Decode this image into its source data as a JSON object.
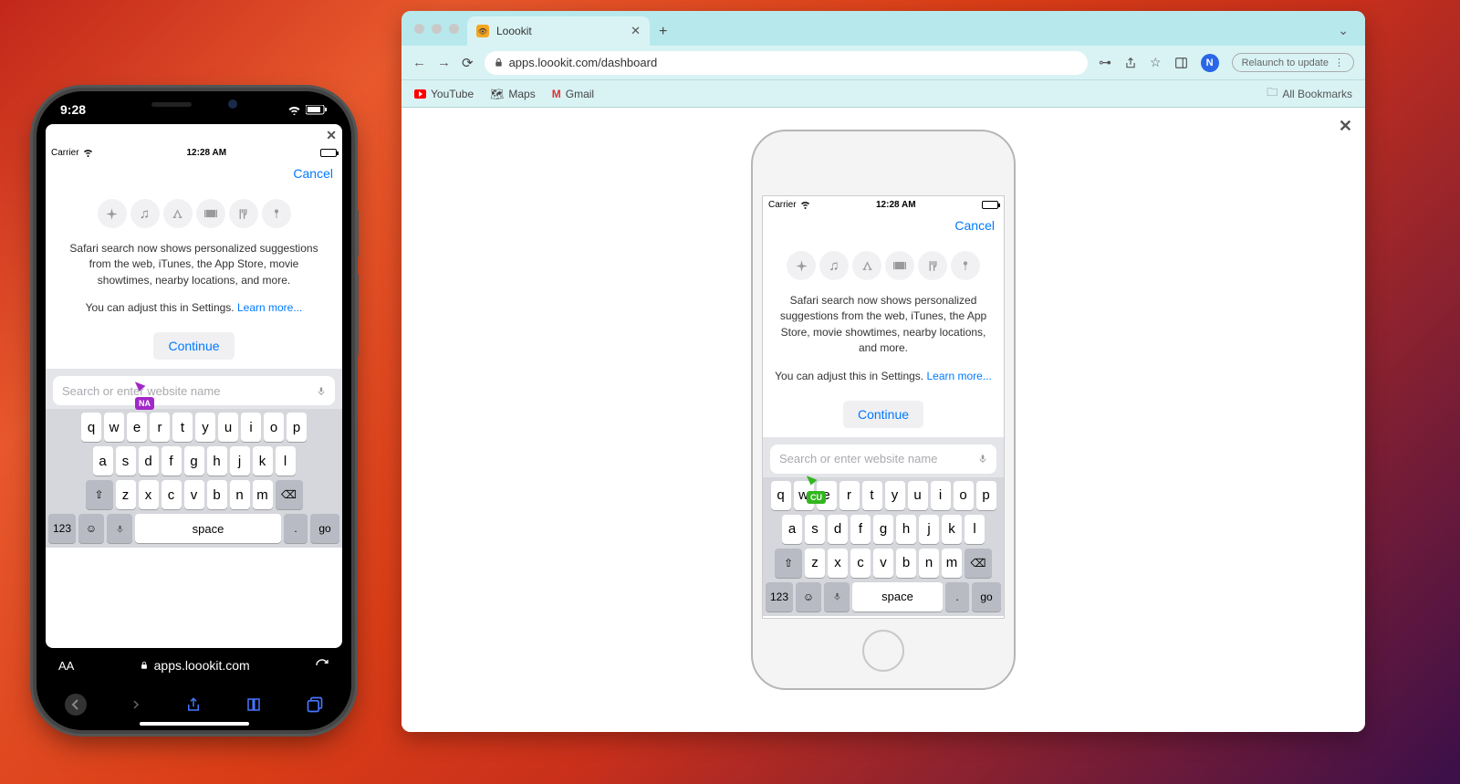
{
  "physical_phone": {
    "status_time": "9:28",
    "tab_indicator": "⌄",
    "safari_url": "apps.loookit.com",
    "aa_button": "AA"
  },
  "browser": {
    "tab_title": "Loookit",
    "address": "apps.loookit.com/dashboard",
    "bookmarks": {
      "yt": "YouTube",
      "maps": "Maps",
      "gmail": "Gmail",
      "all": "All Bookmarks"
    },
    "avatar_letter": "N",
    "relaunch": "Relaunch to update"
  },
  "ios": {
    "carrier": "Carrier",
    "clock": "12:28 AM",
    "cancel": "Cancel",
    "description": "Safari search now shows personalized suggestions from the web, iTunes, the App Store, movie showtimes, nearby locations, and more.",
    "settings_prefix": "You can adjust this in Settings.",
    "learn_more": "Learn more...",
    "continue": "Continue",
    "search_placeholder": "Search or enter website name",
    "keyboard": {
      "row1": [
        "q",
        "w",
        "e",
        "r",
        "t",
        "y",
        "u",
        "i",
        "o",
        "p"
      ],
      "row2": [
        "a",
        "s",
        "d",
        "f",
        "g",
        "h",
        "j",
        "k",
        "l"
      ],
      "row3": [
        "z",
        "x",
        "c",
        "v",
        "b",
        "n",
        "m"
      ],
      "num_key": "123",
      "space": "space",
      "dot": ".",
      "go": "go"
    }
  },
  "cursors": {
    "left": {
      "label": "NA",
      "color": "#a127c9"
    },
    "right": {
      "label": "CU",
      "color": "#33b61f"
    }
  }
}
